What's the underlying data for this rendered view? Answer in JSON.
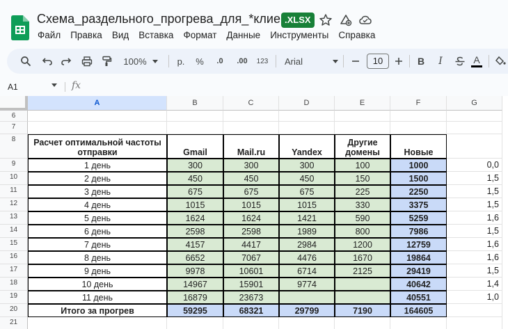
{
  "document": {
    "title": "Схема_раздельного_прогрева_для_*клиент*",
    "format_badge": ".XLSX"
  },
  "menu": [
    "Файл",
    "Правка",
    "Вид",
    "Вставка",
    "Формат",
    "Данные",
    "Инструменты",
    "Справка"
  ],
  "toolbar": {
    "zoom": "100%",
    "currency": "р.",
    "percent": "%",
    "decrease_decimals": ".0",
    "increase_decimals": ".00",
    "number_format": "123",
    "font": "Arial",
    "font_size": "10",
    "bold": "B",
    "italic": "I",
    "text_color": "A"
  },
  "formula_bar": {
    "cell_ref": "A1",
    "fx": "fx"
  },
  "columns": [
    "A",
    "B",
    "C",
    "D",
    "E",
    "F",
    "G"
  ],
  "selected_column": "A",
  "rows": [
    "6",
    "7",
    "8",
    "9",
    "10",
    "11",
    "12",
    "13",
    "14",
    "15",
    "16",
    "17",
    "18",
    "19",
    "20",
    "21"
  ],
  "table": {
    "header": {
      "title_line1": "Расчет оптимальной частоты",
      "title_line2": "отправки",
      "gmail": "Gmail",
      "mailru": "Mail.ru",
      "yandex": "Yandex",
      "other_line1": "Другие",
      "other_line2": "домены",
      "new": "Новые"
    },
    "days": [
      {
        "label": "1 день",
        "gmail": "300",
        "mailru": "300",
        "yandex": "300",
        "other": "100",
        "new": "1000",
        "g": "0,0"
      },
      {
        "label": "2 день",
        "gmail": "450",
        "mailru": "450",
        "yandex": "450",
        "other": "150",
        "new": "1500",
        "g": "1,5"
      },
      {
        "label": "3 день",
        "gmail": "675",
        "mailru": "675",
        "yandex": "675",
        "other": "225",
        "new": "2250",
        "g": "1,5"
      },
      {
        "label": "4 день",
        "gmail": "1015",
        "mailru": "1015",
        "yandex": "1015",
        "other": "330",
        "new": "3375",
        "g": "1,5"
      },
      {
        "label": "5 день",
        "gmail": "1624",
        "mailru": "1624",
        "yandex": "1421",
        "other": "590",
        "new": "5259",
        "g": "1,6"
      },
      {
        "label": "6 день",
        "gmail": "2598",
        "mailru": "2598",
        "yandex": "1989",
        "other": "800",
        "new": "7986",
        "g": "1,5"
      },
      {
        "label": "7 день",
        "gmail": "4157",
        "mailru": "4417",
        "yandex": "2984",
        "other": "1200",
        "new": "12759",
        "g": "1,6"
      },
      {
        "label": "8 день",
        "gmail": "6652",
        "mailru": "7067",
        "yandex": "4476",
        "other": "1670",
        "new": "19864",
        "g": "1,6"
      },
      {
        "label": "9 день",
        "gmail": "9978",
        "mailru": "10601",
        "yandex": "6714",
        "other": "2125",
        "new": "29419",
        "g": "1,5"
      },
      {
        "label": "10 день",
        "gmail": "14967",
        "mailru": "15901",
        "yandex": "9774",
        "other": "",
        "new": "40642",
        "g": "1,4"
      },
      {
        "label": "11 день",
        "gmail": "16879",
        "mailru": "23673",
        "yandex": "",
        "other": "",
        "new": "40551",
        "g": "1,0"
      }
    ],
    "total": {
      "label": "Итого за прогрев",
      "gmail": "59295",
      "mailru": "68321",
      "yandex": "29799",
      "other": "7190",
      "new": "164605"
    }
  }
}
